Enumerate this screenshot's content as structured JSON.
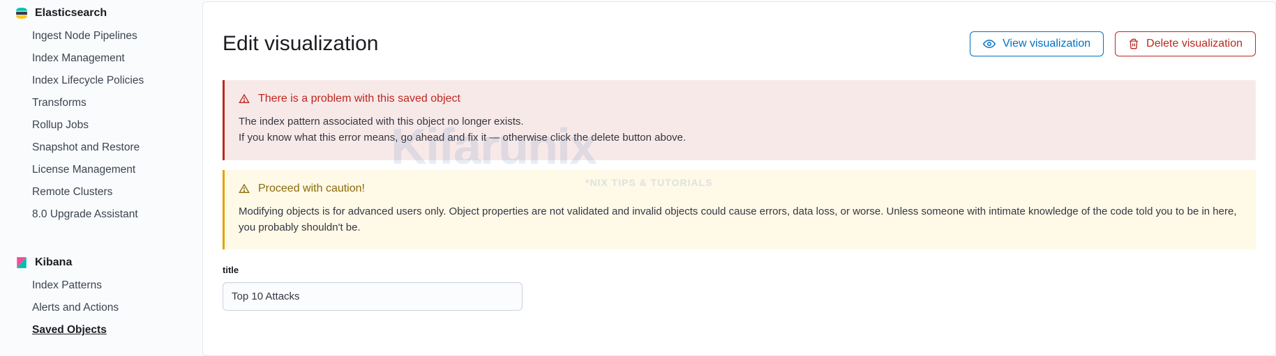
{
  "sidebar": {
    "sections": [
      {
        "id": "elasticsearch",
        "label": "Elasticsearch",
        "items": [
          {
            "label": "Ingest Node Pipelines"
          },
          {
            "label": "Index Management"
          },
          {
            "label": "Index Lifecycle Policies"
          },
          {
            "label": "Transforms"
          },
          {
            "label": "Rollup Jobs"
          },
          {
            "label": "Snapshot and Restore"
          },
          {
            "label": "License Management"
          },
          {
            "label": "Remote Clusters"
          },
          {
            "label": "8.0 Upgrade Assistant"
          }
        ]
      },
      {
        "id": "kibana",
        "label": "Kibana",
        "items": [
          {
            "label": "Index Patterns"
          },
          {
            "label": "Alerts and Actions"
          },
          {
            "label": "Saved Objects",
            "active": true
          }
        ]
      }
    ]
  },
  "page": {
    "title": "Edit visualization"
  },
  "actions": {
    "view": {
      "label": "View visualization"
    },
    "delete": {
      "label": "Delete visualization"
    }
  },
  "callout_error": {
    "title": "There is a problem with this saved object",
    "line1": "The index pattern associated with this object no longer exists.",
    "line2": "If you know what this error means, go ahead and fix it — otherwise click the delete button above."
  },
  "callout_warning": {
    "title": "Proceed with caution!",
    "body": "Modifying objects is for advanced users only. Object properties are not validated and invalid objects could cause errors, data loss, or worse. Unless someone with intimate knowledge of the code told you to be in here, you probably shouldn't be."
  },
  "form": {
    "title": {
      "label": "title",
      "value": "Top 10 Attacks"
    }
  },
  "watermark": {
    "main": "Kifarunix",
    "sub": "*NIX TIPS & TUTORIALS"
  }
}
